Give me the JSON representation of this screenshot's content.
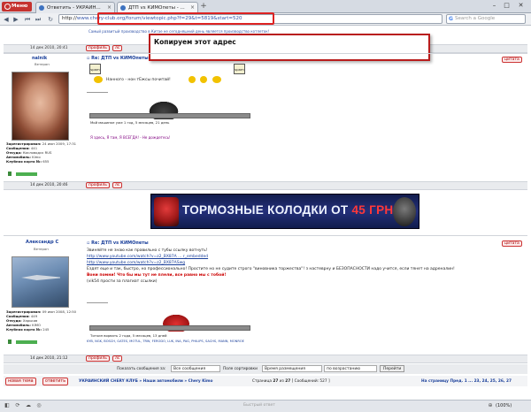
{
  "browser": {
    "menu_label": "Меню",
    "tabs": [
      {
        "title": "Ответить - УКРАИН...",
        "active": false
      },
      {
        "title": "ДТП vs КИМОпеты - ...",
        "active": true
      }
    ],
    "url_host": "http://",
    "url_rest": "www.chery-club.org/forum/viewtopic.php?f=29&t=5819&start=520",
    "search_placeholder": "Search a Google",
    "zoom": "(100%)",
    "quick_reply": "Быстрый ответ"
  },
  "callout": {
    "text": "Копируем этот адрес"
  },
  "notice": "Самый развитый производство в Китае не сегодняшний день является производство котлеток!",
  "post1": {
    "date_top": "14 дек 2010, 20:41",
    "author": "nalnik",
    "rank": "Ветеран",
    "subject": "Re: ДТП vs КИМОпеты",
    "time": "",
    "spam1": "spam",
    "spam2": "spam",
    "body": "Нанного - нон тЕжсы почитай!",
    "signature": "Я здесь, Я там, Я ВСЕГДА! - Не дождетесь!",
    "car_caption": "Мой машинке уже 1 год, 5 месяцев, 21 день",
    "info": {
      "registered_label": "Зарегистрирован:",
      "registered": "24 июн 2009, 17:31",
      "posts_label": "Сообщения:",
      "posts": "441",
      "from_label": "Откуда:",
      "from": "Кисловодск RUS",
      "car_label": "Автомобиль:",
      "car": "Kimo",
      "club_label": "Клубная карта №:",
      "club": "655"
    },
    "date_bottom": "14 дек 2010, 20:46"
  },
  "banner": {
    "text": "ТОРМОЗНЫЕ КОЛОДКИ ОТ ",
    "price": "45 ГРН"
  },
  "post2": {
    "author": "Александр С",
    "rank": "Ветеран",
    "subject": "Re: ДТП vs КИМОпеты",
    "lines": [
      "Звиняйте не знаю как правильно с тубы ссылку вотнуть!",
      "http://www.youtube.com/watch?v=z2_BX87A ... r_embedded",
      "http://www.youtube.com/watch?v=z2_BX87ASwg",
      "Ездят еще и так, быстро, но профессионально! Простите но не судите строго \"виновника торжества\"! з настеврну и БЕЗОПАСНОСТИ надо учится, если тянет на адреналин!",
      "Вони помни! Что бы мы тут не плели, все равно мы с тобой!",
      "(vik54 прости за плагиат ссылки)"
    ],
    "car_caption": "Тоткин ворвать 2 года, 5 месяцев, 13 дней",
    "sponsors": "KYB, NGK, BOSCH, GATES, MOTUL, TRW, FERODO, LUK, INA, PAG, PHILIPS, SACHS, MANN, MONROE",
    "info": {
      "registered_label": "Зарегистрирован:",
      "registered": "09 июн 2008, 12:50",
      "posts_label": "Сообщения:",
      "posts": "449",
      "from_label": "Откуда:",
      "from": "Харьков",
      "car_label": "Автомобиль:",
      "car": "KIMO",
      "club_label": "Клубная карта №:",
      "club": "245"
    },
    "date_bottom": "14 дек 2010, 21:12"
  },
  "buttons": {
    "profile": "профиль",
    "pm": "лс",
    "quote": "цитата"
  },
  "sort": {
    "show_label": "Показать сообщения за:",
    "show_value": "Все сообщения",
    "sort_label": "Поле сортировки",
    "sort_value": "Время размещения",
    "order_value": "по возрастанию",
    "go": "Перейти"
  },
  "footer": {
    "new_topic": "новая тема",
    "reply": "ответить",
    "breadcrumb": "УКРАИНСКИЙ CHERY КЛУБ » Наши автомобили » Chery Kimo",
    "page_info_pre": "Страница",
    "page_cur": "27",
    "page_of": "из",
    "page_total": "27",
    "count": "[ Сообщений: 527 ]",
    "pages_label": "На страницу",
    "pages_prev": "Пред.",
    "pages_list": "1 ... 23, 24, 25, 26, 27"
  }
}
